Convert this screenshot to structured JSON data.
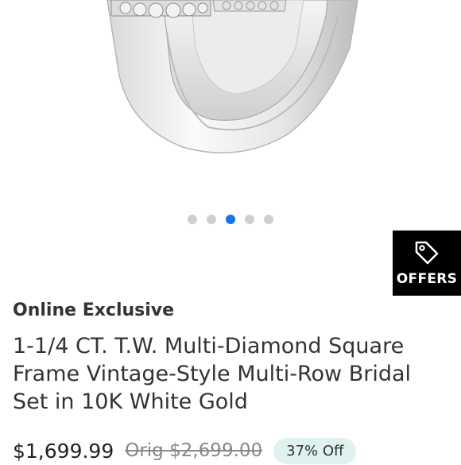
{
  "product": {
    "badge": "Online Exclusive",
    "title": "1-1/4 CT. T.W. Multi-Diamond Square Frame Vintage-Style Multi-Row Bridal Set in 10K White Gold",
    "price": "$1,699.99",
    "original_price": "Orig $2,699.00",
    "discount": "37% Off"
  },
  "offers_button": {
    "label": "OFFERS",
    "icon": "tag-icon"
  },
  "carousel": {
    "total": 5,
    "active_index": 3
  },
  "colors": {
    "active_dot": "#1a73e8",
    "inactive_dot": "#cfcfcf",
    "offers_bg": "#000000",
    "discount_bg": "#e0f2ef"
  }
}
